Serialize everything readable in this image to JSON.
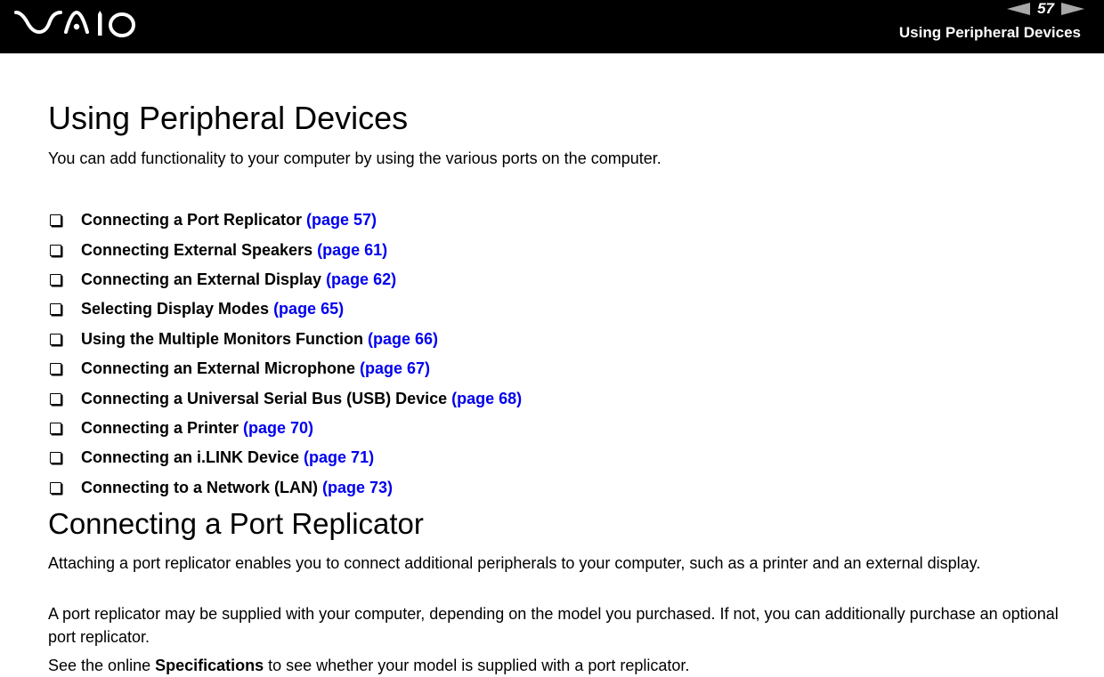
{
  "header": {
    "logo_text": "VAIO",
    "page_number": "57",
    "section_title": "Using Peripheral Devices",
    "prev_icon": "left-triangle-arrow",
    "next_icon": "right-triangle-arrow"
  },
  "main": {
    "title": "Using Peripheral Devices",
    "intro": "You can add functionality to your computer by using the various ports on the computer.",
    "toc": [
      {
        "label": "Connecting a Port Replicator",
        "link": "(page 57)"
      },
      {
        "label": "Connecting External Speakers",
        "link": "(page 61)"
      },
      {
        "label": "Connecting an External Display",
        "link": "(page 62)"
      },
      {
        "label": "Selecting Display Modes",
        "link": "(page 65)"
      },
      {
        "label": "Using the Multiple Monitors Function",
        "link": "(page 66)"
      },
      {
        "label": "Connecting an External Microphone",
        "link": "(page 67)"
      },
      {
        "label": "Connecting a Universal Serial Bus (USB) Device",
        "link": "(page 68)"
      },
      {
        "label": "Connecting a Printer",
        "link": "(page 70)"
      },
      {
        "label": "Connecting an i.LINK Device",
        "link": "(page 71)"
      },
      {
        "label": "Connecting to a Network (LAN)",
        "link": "(page 73)"
      }
    ],
    "section": {
      "title": "Connecting a Port Replicator",
      "p1": "Attaching a port replicator enables you to connect additional peripherals to your computer, such as a printer and an external display.",
      "p2": "A port replicator may be supplied with your computer, depending on the model you purchased. If not, you can additionally purchase an optional port replicator.",
      "p3_before": "See the online ",
      "p3_bold": "Specifications",
      "p3_after": " to see whether your model is supplied with a port replicator."
    }
  },
  "colors": {
    "header_bg": "#000000",
    "link": "#0000ee",
    "nav_arrow": "#a8a8a8"
  }
}
